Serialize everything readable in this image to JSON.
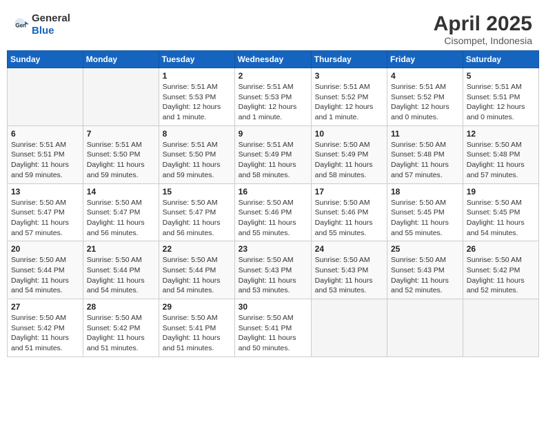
{
  "logo": {
    "general": "General",
    "blue": "Blue"
  },
  "header": {
    "title": "April 2025",
    "subtitle": "Cisompet, Indonesia"
  },
  "weekdays": [
    "Sunday",
    "Monday",
    "Tuesday",
    "Wednesday",
    "Thursday",
    "Friday",
    "Saturday"
  ],
  "weeks": [
    [
      {
        "day": "",
        "info": ""
      },
      {
        "day": "",
        "info": ""
      },
      {
        "day": "1",
        "info": "Sunrise: 5:51 AM\nSunset: 5:53 PM\nDaylight: 12 hours and 1 minute."
      },
      {
        "day": "2",
        "info": "Sunrise: 5:51 AM\nSunset: 5:53 PM\nDaylight: 12 hours and 1 minute."
      },
      {
        "day": "3",
        "info": "Sunrise: 5:51 AM\nSunset: 5:52 PM\nDaylight: 12 hours and 1 minute."
      },
      {
        "day": "4",
        "info": "Sunrise: 5:51 AM\nSunset: 5:52 PM\nDaylight: 12 hours and 0 minutes."
      },
      {
        "day": "5",
        "info": "Sunrise: 5:51 AM\nSunset: 5:51 PM\nDaylight: 12 hours and 0 minutes."
      }
    ],
    [
      {
        "day": "6",
        "info": "Sunrise: 5:51 AM\nSunset: 5:51 PM\nDaylight: 11 hours and 59 minutes."
      },
      {
        "day": "7",
        "info": "Sunrise: 5:51 AM\nSunset: 5:50 PM\nDaylight: 11 hours and 59 minutes."
      },
      {
        "day": "8",
        "info": "Sunrise: 5:51 AM\nSunset: 5:50 PM\nDaylight: 11 hours and 59 minutes."
      },
      {
        "day": "9",
        "info": "Sunrise: 5:51 AM\nSunset: 5:49 PM\nDaylight: 11 hours and 58 minutes."
      },
      {
        "day": "10",
        "info": "Sunrise: 5:50 AM\nSunset: 5:49 PM\nDaylight: 11 hours and 58 minutes."
      },
      {
        "day": "11",
        "info": "Sunrise: 5:50 AM\nSunset: 5:48 PM\nDaylight: 11 hours and 57 minutes."
      },
      {
        "day": "12",
        "info": "Sunrise: 5:50 AM\nSunset: 5:48 PM\nDaylight: 11 hours and 57 minutes."
      }
    ],
    [
      {
        "day": "13",
        "info": "Sunrise: 5:50 AM\nSunset: 5:47 PM\nDaylight: 11 hours and 57 minutes."
      },
      {
        "day": "14",
        "info": "Sunrise: 5:50 AM\nSunset: 5:47 PM\nDaylight: 11 hours and 56 minutes."
      },
      {
        "day": "15",
        "info": "Sunrise: 5:50 AM\nSunset: 5:47 PM\nDaylight: 11 hours and 56 minutes."
      },
      {
        "day": "16",
        "info": "Sunrise: 5:50 AM\nSunset: 5:46 PM\nDaylight: 11 hours and 55 minutes."
      },
      {
        "day": "17",
        "info": "Sunrise: 5:50 AM\nSunset: 5:46 PM\nDaylight: 11 hours and 55 minutes."
      },
      {
        "day": "18",
        "info": "Sunrise: 5:50 AM\nSunset: 5:45 PM\nDaylight: 11 hours and 55 minutes."
      },
      {
        "day": "19",
        "info": "Sunrise: 5:50 AM\nSunset: 5:45 PM\nDaylight: 11 hours and 54 minutes."
      }
    ],
    [
      {
        "day": "20",
        "info": "Sunrise: 5:50 AM\nSunset: 5:44 PM\nDaylight: 11 hours and 54 minutes."
      },
      {
        "day": "21",
        "info": "Sunrise: 5:50 AM\nSunset: 5:44 PM\nDaylight: 11 hours and 54 minutes."
      },
      {
        "day": "22",
        "info": "Sunrise: 5:50 AM\nSunset: 5:44 PM\nDaylight: 11 hours and 54 minutes."
      },
      {
        "day": "23",
        "info": "Sunrise: 5:50 AM\nSunset: 5:43 PM\nDaylight: 11 hours and 53 minutes."
      },
      {
        "day": "24",
        "info": "Sunrise: 5:50 AM\nSunset: 5:43 PM\nDaylight: 11 hours and 53 minutes."
      },
      {
        "day": "25",
        "info": "Sunrise: 5:50 AM\nSunset: 5:43 PM\nDaylight: 11 hours and 52 minutes."
      },
      {
        "day": "26",
        "info": "Sunrise: 5:50 AM\nSunset: 5:42 PM\nDaylight: 11 hours and 52 minutes."
      }
    ],
    [
      {
        "day": "27",
        "info": "Sunrise: 5:50 AM\nSunset: 5:42 PM\nDaylight: 11 hours and 51 minutes."
      },
      {
        "day": "28",
        "info": "Sunrise: 5:50 AM\nSunset: 5:42 PM\nDaylight: 11 hours and 51 minutes."
      },
      {
        "day": "29",
        "info": "Sunrise: 5:50 AM\nSunset: 5:41 PM\nDaylight: 11 hours and 51 minutes."
      },
      {
        "day": "30",
        "info": "Sunrise: 5:50 AM\nSunset: 5:41 PM\nDaylight: 11 hours and 50 minutes."
      },
      {
        "day": "",
        "info": ""
      },
      {
        "day": "",
        "info": ""
      },
      {
        "day": "",
        "info": ""
      }
    ]
  ]
}
